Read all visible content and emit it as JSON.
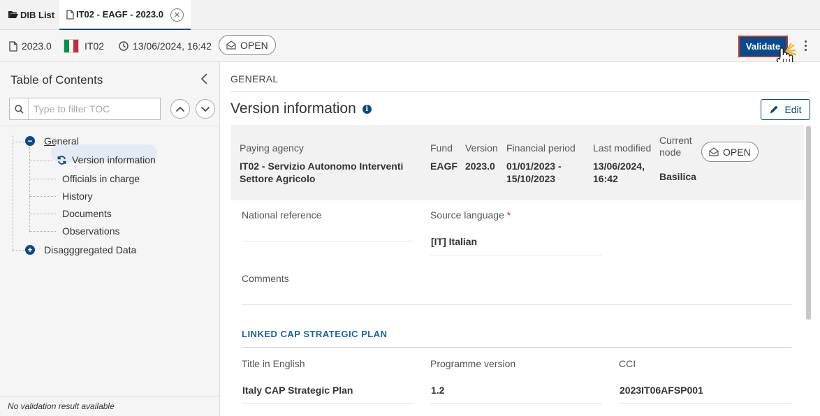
{
  "tabs": {
    "list_label": "DIB List",
    "active_label": "IT02 - EAGF - 2023.0",
    "close_icon": "close-icon"
  },
  "infobar": {
    "version": "2023.0",
    "country_code": "IT02",
    "datetime": "13/06/2024, 16:42",
    "status": "OPEN",
    "validate_label": "Validate",
    "flag_colors": [
      "#009246",
      "#ffffff",
      "#ce2b37"
    ]
  },
  "sidebar": {
    "title": "Table of Contents",
    "filter_placeholder": "Type to filter TOC",
    "tree": {
      "general": "General",
      "children": [
        "Version information",
        "Officials in charge",
        "History",
        "Documents",
        "Observations"
      ],
      "disaggregated": "Disagggregated Data"
    },
    "footer": "No validation result available"
  },
  "main": {
    "breadcrumb": "GENERAL",
    "title": "Version information",
    "edit_label": "Edit",
    "summary": {
      "paying_agency_label": "Paying agency",
      "paying_agency_value_1": "IT02 - Servizio Autonomo Interventi",
      "paying_agency_value_2": "Settore Agricolo",
      "fund_label": "Fund",
      "fund_value": "EAGF",
      "version_label": "Version",
      "version_value": "2023.0",
      "financial_period_label": "Financial period",
      "financial_period_value_1": "01/01/2023 -",
      "financial_period_value_2": "15/10/2023",
      "last_modified_label": "Last modified",
      "last_modified_value_1": "13/06/2024,",
      "last_modified_value_2": "16:42",
      "current_node_label_1": "Current",
      "current_node_label_2": "node",
      "current_node_value": "Basilica",
      "status": "OPEN"
    },
    "fields": {
      "national_reference_label": "National reference",
      "national_reference_value": "",
      "source_language_label": "Source language",
      "required_mark": "*",
      "source_language_value": "[IT] Italian",
      "comments_label": "Comments",
      "comments_value": ""
    },
    "linked_plan": {
      "section_title": "LINKED CAP STRATEGIC PLAN",
      "title_label": "Title in English",
      "title_value": "Italy CAP Strategic Plan",
      "programme_version_label": "Programme version",
      "programme_version_value": "1.2",
      "cci_label": "CCI",
      "cci_value": "2023IT06AFSP001"
    }
  }
}
